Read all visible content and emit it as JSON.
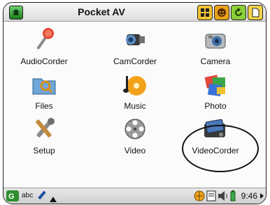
{
  "header": {
    "title": "Pocket AV",
    "home_icon": "app-home-icon",
    "buttons": [
      {
        "icon": "grid-view-icon",
        "color": "#f2c230"
      },
      {
        "icon": "smiley-icon",
        "color": "#e8a21a"
      },
      {
        "icon": "refresh-icon",
        "color": "#8ccf3a"
      },
      {
        "icon": "page-icon",
        "color": "#f2d14a"
      }
    ]
  },
  "apps": [
    {
      "label": "AudioCorder",
      "icon": "microphone-icon"
    },
    {
      "label": "CamCorder",
      "icon": "camcorder-icon"
    },
    {
      "label": "Camera",
      "icon": "camera-icon"
    },
    {
      "label": "Files",
      "icon": "files-icon"
    },
    {
      "label": "Music",
      "icon": "music-icon"
    },
    {
      "label": "Photo",
      "icon": "photo-icon"
    },
    {
      "label": "Setup",
      "icon": "tools-icon"
    },
    {
      "label": "Video",
      "icon": "film-reel-icon"
    },
    {
      "label": "VideoCorder",
      "icon": "videocorder-icon"
    }
  ],
  "statusbar": {
    "input_mode": "abc",
    "time": "9:46"
  },
  "colors": {
    "titlebar": "#dcdcdc",
    "statusbar": "#cfcfcf",
    "highlight_ring": "#111111"
  }
}
